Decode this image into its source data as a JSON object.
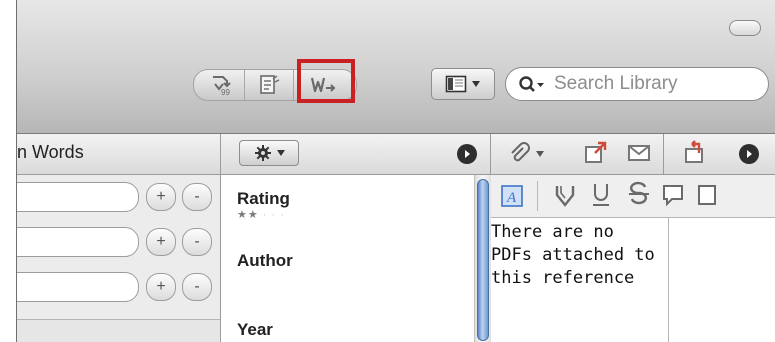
{
  "toolbar": {
    "search": {
      "placeholder": "Search Library",
      "value": ""
    },
    "convert_buttons": [
      {
        "icon": "reference-convert-icon"
      },
      {
        "icon": "document-notes-icon"
      },
      {
        "icon": "word-export-icon",
        "highlighted": true
      }
    ],
    "view_button_icon": "sidebar-layout-icon",
    "highlight_color": "#c92121"
  },
  "header": {
    "words_label": "n Words"
  },
  "search_fields": [
    {
      "value": "",
      "add": "+",
      "remove": "-"
    },
    {
      "value": "",
      "add": "+",
      "remove": "-"
    },
    {
      "value": "",
      "add": "+",
      "remove": "-"
    }
  ],
  "details": {
    "rating_label": "Rating",
    "rating_value": 2,
    "rating_max": 5,
    "author_label": "Author",
    "year_label": "Year"
  },
  "pdf_panel": {
    "lines": [
      "There are no",
      "PDFs attached to",
      "this reference"
    ]
  },
  "colors": {
    "scroll_thumb": "#6f98d4",
    "annotation_blue": "#3d73c9"
  }
}
